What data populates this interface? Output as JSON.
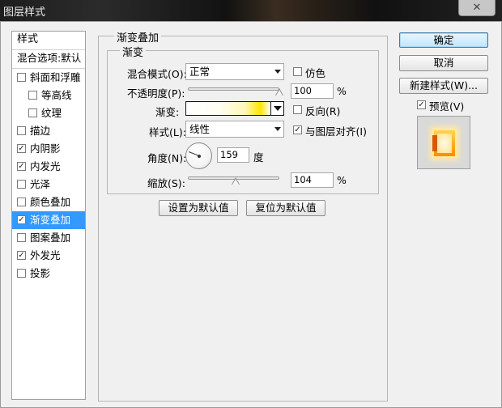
{
  "window": {
    "title": "图层样式",
    "close_glyph": "✕"
  },
  "style_list": {
    "header": "样式",
    "blend_options": "混合选项:默认",
    "items": [
      {
        "label": "斜面和浮雕",
        "checked": false,
        "sub": false,
        "selected": false
      },
      {
        "label": "等高线",
        "checked": false,
        "sub": true,
        "selected": false
      },
      {
        "label": "纹理",
        "checked": false,
        "sub": true,
        "selected": false
      },
      {
        "label": "描边",
        "checked": false,
        "sub": false,
        "selected": false
      },
      {
        "label": "内阴影",
        "checked": true,
        "sub": false,
        "selected": false
      },
      {
        "label": "内发光",
        "checked": true,
        "sub": false,
        "selected": false
      },
      {
        "label": "光泽",
        "checked": false,
        "sub": false,
        "selected": false
      },
      {
        "label": "颜色叠加",
        "checked": false,
        "sub": false,
        "selected": false
      },
      {
        "label": "渐变叠加",
        "checked": true,
        "sub": false,
        "selected": true
      },
      {
        "label": "图案叠加",
        "checked": false,
        "sub": false,
        "selected": false
      },
      {
        "label": "外发光",
        "checked": true,
        "sub": false,
        "selected": false
      },
      {
        "label": "投影",
        "checked": false,
        "sub": false,
        "selected": false
      }
    ]
  },
  "panel": {
    "group_title": "渐变叠加",
    "subgroup_title": "渐变",
    "blend_mode_label": "混合模式(O):",
    "blend_mode_value": "正常",
    "dither_label": "仿色",
    "opacity_label": "不透明度(P):",
    "opacity_value": "100",
    "opacity_fraction": 1.0,
    "percent": "%",
    "gradient_label": "渐变:",
    "reverse_label": "反向(R)",
    "style_label": "样式(L):",
    "style_value": "线性",
    "align_label": "与图层对齐(I)",
    "align_checked": true,
    "angle_label": "角度(N):",
    "angle_value": "159",
    "angle_unit": "度",
    "scale_label": "缩放(S):",
    "scale_value": "104",
    "scale_fraction": 0.52,
    "make_default": "设置为默认值",
    "reset_default": "复位为默认值"
  },
  "right": {
    "ok": "确定",
    "cancel": "取消",
    "new_style": "新建样式(W)...",
    "preview_label": "预览(V)",
    "preview_checked": true
  },
  "checkmark": "✓"
}
